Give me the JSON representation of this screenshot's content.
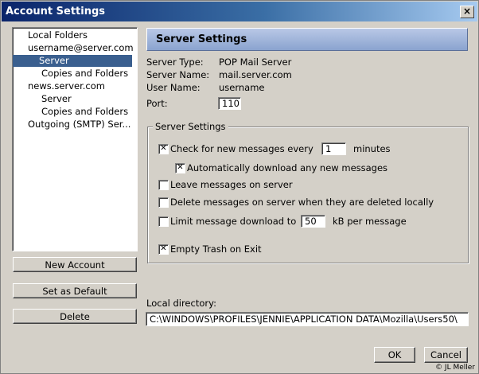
{
  "window": {
    "title": "Account Settings",
    "close_glyph": "×"
  },
  "tree": {
    "items": [
      {
        "label": "Local Folders"
      },
      {
        "label": "username@server.com"
      },
      {
        "label": "Server"
      },
      {
        "label": "Copies and Folders"
      },
      {
        "label": "news.server.com"
      },
      {
        "label": "Server"
      },
      {
        "label": "Copies and Folders"
      },
      {
        "label": "Outgoing (SMTP) Ser..."
      }
    ],
    "selected_index": 2
  },
  "buttons": {
    "new_account": "New Account",
    "set_default": "Set as Default",
    "delete": "Delete",
    "ok": "OK",
    "cancel": "Cancel"
  },
  "panel": {
    "header": "Server Settings",
    "server_type_label": "Server Type:",
    "server_type_value": "POP Mail Server",
    "server_name_label": "Server Name:",
    "server_name_value": "mail.server.com",
    "user_name_label": "User Name:",
    "user_name_value": "username",
    "port_label": "Port:",
    "port_value": "110"
  },
  "group": {
    "title": "Server Settings",
    "check_new_label": "Check for new messages every",
    "check_new_checked": true,
    "check_interval": "1",
    "minutes_label": "minutes",
    "auto_download_label": "Automatically download any new messages",
    "auto_download_checked": true,
    "leave_messages_label": "Leave messages on server",
    "leave_messages_checked": false,
    "delete_on_server_label": "Delete messages on server when they are deleted locally",
    "delete_on_server_checked": false,
    "limit_download_label": "Limit message download to",
    "limit_download_checked": false,
    "limit_value": "50",
    "kb_label": "kB per message",
    "empty_trash_label": "Empty Trash on Exit",
    "empty_trash_checked": true
  },
  "local_directory": {
    "label": "Local directory:",
    "value": "C:\\WINDOWS\\PROFILES\\JENNIE\\APPLICATION DATA\\Mozilla\\Users50\\"
  },
  "credit": "© JL Meller"
}
